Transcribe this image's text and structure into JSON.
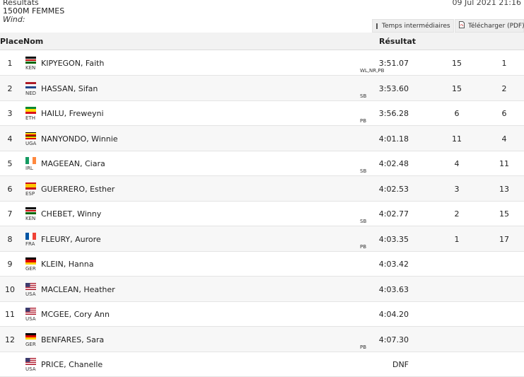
{
  "header": {
    "title": "Resultats",
    "event": "1500M FEMMES",
    "wind_label": "Wind:",
    "datetime": "09 Jul 2021 21:16"
  },
  "toolbar": {
    "splits_label": "Temps intermédiaires",
    "download_label": "Télécharger (PDF)"
  },
  "table": {
    "columns": {
      "place": "Place",
      "name": "Nom",
      "result": "Résultat"
    },
    "rows": [
      {
        "place": "1",
        "country": "KEN",
        "name": "KIPYEGON, Faith",
        "result": "3:51.07",
        "mark": "WL,NR,PB",
        "col_a": "15",
        "col_b": "1"
      },
      {
        "place": "2",
        "country": "NED",
        "name": "HASSAN, Sifan",
        "result": "3:53.60",
        "mark": "SB",
        "col_a": "15",
        "col_b": "2"
      },
      {
        "place": "3",
        "country": "ETH",
        "name": "HAILU, Freweyni",
        "result": "3:56.28",
        "mark": "PB",
        "col_a": "6",
        "col_b": "6"
      },
      {
        "place": "4",
        "country": "UGA",
        "name": "NANYONDO, Winnie",
        "result": "4:01.18",
        "mark": "",
        "col_a": "11",
        "col_b": "4"
      },
      {
        "place": "5",
        "country": "IRL",
        "name": "MAGEEAN, Ciara",
        "result": "4:02.48",
        "mark": "SB",
        "col_a": "4",
        "col_b": "11"
      },
      {
        "place": "6",
        "country": "ESP",
        "name": "GUERRERO, Esther",
        "result": "4:02.53",
        "mark": "",
        "col_a": "3",
        "col_b": "13"
      },
      {
        "place": "7",
        "country": "KEN",
        "name": "CHEBET, Winny",
        "result": "4:02.77",
        "mark": "SB",
        "col_a": "2",
        "col_b": "15"
      },
      {
        "place": "8",
        "country": "FRA",
        "name": "FLEURY, Aurore",
        "result": "4:03.35",
        "mark": "PB",
        "col_a": "1",
        "col_b": "17"
      },
      {
        "place": "9",
        "country": "GER",
        "name": "KLEIN, Hanna",
        "result": "4:03.42",
        "mark": "",
        "col_a": "",
        "col_b": ""
      },
      {
        "place": "10",
        "country": "USA",
        "name": "MACLEAN, Heather",
        "result": "4:03.63",
        "mark": "",
        "col_a": "",
        "col_b": ""
      },
      {
        "place": "11",
        "country": "USA",
        "name": "MCGEE, Cory Ann",
        "result": "4:04.20",
        "mark": "",
        "col_a": "",
        "col_b": ""
      },
      {
        "place": "12",
        "country": "GER",
        "name": "BENFARES, Sara",
        "result": "4:07.30",
        "mark": "PB",
        "col_a": "",
        "col_b": ""
      },
      {
        "place": "",
        "country": "USA",
        "name": "PRICE, Chanelle",
        "result": "DNF",
        "mark": "",
        "col_a": "",
        "col_b": ""
      }
    ]
  }
}
